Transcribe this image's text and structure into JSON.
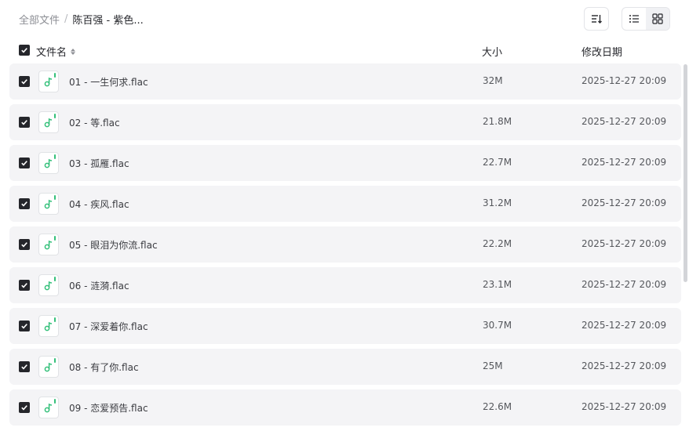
{
  "breadcrumb": {
    "root": "全部文件",
    "separator": "/",
    "current": "陈百强 - 紫色..."
  },
  "toolbar": {
    "sort_icon": "sort-icon",
    "list_view_icon": "list-view-icon",
    "grid_view_icon": "grid-view-icon"
  },
  "header": {
    "name": "文件名",
    "size": "大小",
    "modified": "修改日期"
  },
  "accent_color": "#34c07a",
  "files": [
    {
      "name": "01 - 一生何求.flac",
      "size": "32M",
      "modified": "2025-12-27 20:09"
    },
    {
      "name": "02 - 等.flac",
      "size": "21.8M",
      "modified": "2025-12-27 20:09"
    },
    {
      "name": "03 - 孤雁.flac",
      "size": "22.7M",
      "modified": "2025-12-27 20:09"
    },
    {
      "name": "04 - 疾风.flac",
      "size": "31.2M",
      "modified": "2025-12-27 20:09"
    },
    {
      "name": "05 - 眼泪为你流.flac",
      "size": "22.2M",
      "modified": "2025-12-27 20:09"
    },
    {
      "name": "06 - 涟漪.flac",
      "size": "23.1M",
      "modified": "2025-12-27 20:09"
    },
    {
      "name": "07 - 深爱着你.flac",
      "size": "30.7M",
      "modified": "2025-12-27 20:09"
    },
    {
      "name": "08 - 有了你.flac",
      "size": "25M",
      "modified": "2025-12-27 20:09"
    },
    {
      "name": "09 - 恋爱预告.flac",
      "size": "22.6M",
      "modified": "2025-12-27 20:09"
    }
  ]
}
